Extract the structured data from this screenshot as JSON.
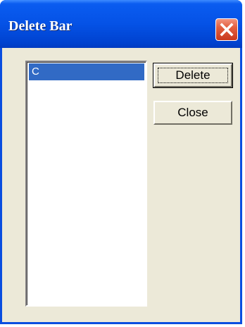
{
  "window": {
    "title": "Delete Bar",
    "close_icon": "close-x-icon"
  },
  "list": {
    "items": [
      "C"
    ],
    "selected_index": 0
  },
  "buttons": {
    "delete_label": "Delete",
    "close_label": "Close"
  },
  "colors": {
    "titlebar": "#0552e6",
    "selection": "#316ac5",
    "client_bg": "#ece9d8",
    "close_button": "#e25f3f"
  }
}
